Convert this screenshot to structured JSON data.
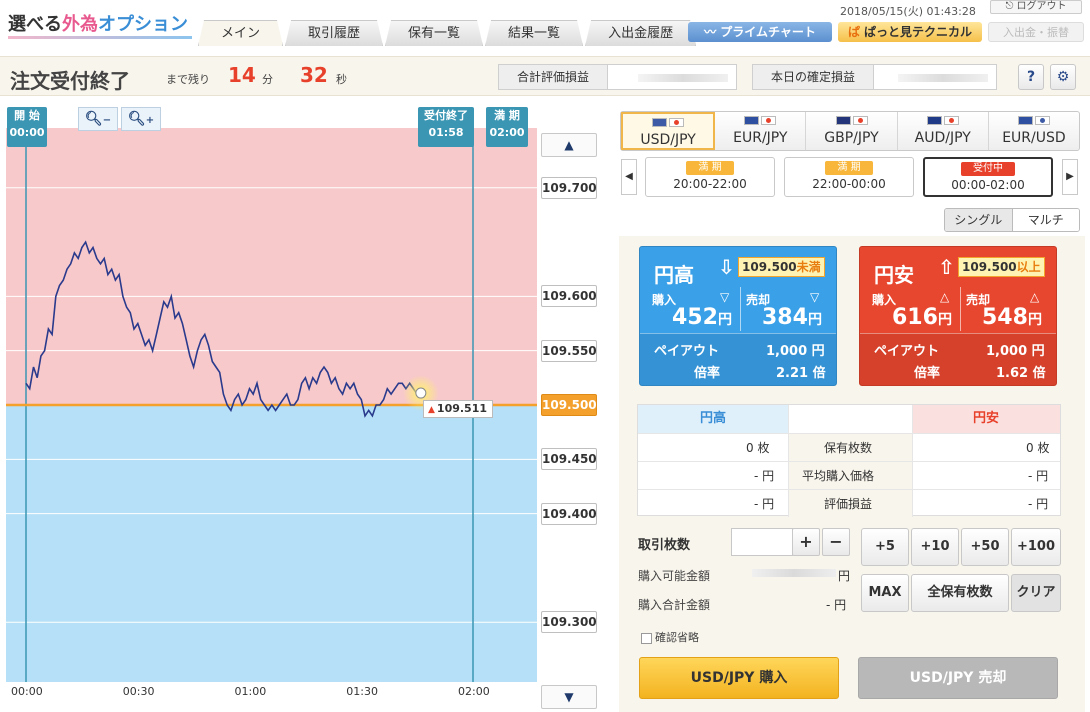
{
  "header": {
    "logo_a": "選べる",
    "logo_b": "外為",
    "logo_c": "オプション",
    "tabs": [
      {
        "label": "メイン",
        "active": true
      },
      {
        "label": "取引履歴",
        "active": false
      },
      {
        "label": "保有一覧",
        "active": false
      },
      {
        "label": "結果一覧",
        "active": false
      },
      {
        "label": "入出金履歴",
        "active": false
      }
    ],
    "prime_chart": "プライムチャート",
    "quick_tech_mark": "ぱ",
    "quick_tech": "ぱっと見テクニカル",
    "deposit": "入出金・振替",
    "datetime": "2018/05/15(火) 01:43:28",
    "logout": "ログアウト"
  },
  "status": {
    "title": "注文受付終了",
    "remain_label": "まで残り",
    "minutes": "14",
    "minutes_unit": "分",
    "seconds": "32",
    "seconds_unit": "秒",
    "total_pnl_label": "合計評価損益",
    "today_pnl_label": "本日の確定損益",
    "help": "?",
    "settings": "⚙"
  },
  "chart": {
    "start_flag_label": "開 始",
    "start_flag_time": "00:00",
    "close_flag_label": "受付終了",
    "close_flag_time": "01:58",
    "expiry_flag_label": "満 期",
    "expiry_flag_time": "02:00",
    "zoom_out": "−",
    "zoom_in": "+",
    "scroll_up": "▲",
    "scroll_down": "▼",
    "current_price": "109.511",
    "strike_price": "109.500",
    "colors": {
      "above": "#f7c9cb",
      "below": "#b6e0f7",
      "line": "#2a3a8c",
      "strike": "#f3a02d"
    }
  },
  "chart_data": {
    "type": "line",
    "x_ticks": [
      "00:00",
      "00:30",
      "01:00",
      "01:30",
      "02:00"
    ],
    "y_ticks": [
      "109.700",
      "109.600",
      "109.550",
      "109.500",
      "109.450",
      "109.400",
      "109.300"
    ],
    "xlim": [
      0,
      120
    ],
    "ylim": [
      109.245,
      109.755
    ],
    "strike": 109.5,
    "series": [
      {
        "x": [
          0,
          1,
          2,
          3,
          4,
          5,
          6,
          7,
          8,
          9,
          10,
          11,
          12,
          13,
          14,
          15,
          16,
          17,
          18,
          19,
          20,
          21,
          22,
          23,
          24,
          25,
          26,
          27,
          28,
          29,
          30,
          31,
          32,
          33,
          34,
          35,
          36,
          37,
          38,
          39,
          40,
          41,
          42,
          43,
          44,
          45,
          46,
          47,
          48,
          49,
          50,
          51,
          52,
          53,
          54,
          55,
          56,
          57,
          58,
          59,
          60,
          61,
          62,
          63,
          64,
          65,
          66,
          67,
          68,
          69,
          70,
          71,
          72,
          73,
          74,
          75,
          76,
          77,
          78,
          79,
          80,
          81,
          82,
          83,
          84,
          85,
          86,
          87,
          88,
          89,
          90,
          91,
          92,
          93,
          94,
          95,
          96,
          97,
          98,
          99,
          100,
          101,
          102,
          103,
          104,
          105,
          106
        ],
        "y": [
          109.52,
          109.515,
          109.535,
          109.525,
          109.545,
          109.55,
          109.57,
          109.565,
          109.6,
          109.61,
          109.615,
          109.625,
          109.63,
          109.64,
          109.635,
          109.645,
          109.65,
          109.64,
          109.645,
          109.635,
          109.63,
          109.635,
          109.62,
          109.625,
          109.615,
          109.62,
          109.6,
          109.59,
          109.585,
          109.57,
          109.575,
          109.565,
          109.555,
          109.56,
          109.55,
          109.565,
          109.58,
          109.595,
          109.59,
          109.6,
          109.58,
          109.585,
          109.575,
          109.56,
          109.545,
          109.535,
          109.55,
          109.56,
          109.565,
          109.555,
          109.54,
          109.535,
          109.53,
          109.51,
          109.5,
          109.495,
          109.505,
          109.51,
          109.5,
          109.505,
          109.515,
          109.51,
          109.52,
          109.505,
          109.5,
          109.495,
          109.5,
          109.495,
          109.5,
          109.505,
          109.51,
          109.5,
          109.5,
          109.505,
          109.52,
          109.525,
          109.515,
          109.525,
          109.52,
          109.53,
          109.535,
          109.53,
          109.52,
          109.525,
          109.515,
          109.51,
          109.52,
          109.515,
          109.52,
          109.51,
          109.505,
          109.49,
          109.495,
          109.49,
          109.5,
          109.5,
          109.505,
          109.515,
          109.51,
          109.515,
          109.52,
          109.52,
          109.515,
          109.52,
          109.515,
          109.51,
          109.511
        ]
      }
    ]
  },
  "pairs": [
    {
      "name": "USD/JPY",
      "active": true,
      "flag1": "#3c5aa6",
      "flag2": "#e8412b"
    },
    {
      "name": "EUR/JPY",
      "active": false,
      "flag1": "#2f4fa0",
      "flag2": "#e8412b"
    },
    {
      "name": "GBP/JPY",
      "active": false,
      "flag1": "#24357a",
      "flag2": "#e8412b"
    },
    {
      "name": "AUD/JPY",
      "active": false,
      "flag1": "#1f3a86",
      "flag2": "#e8412b"
    },
    {
      "name": "EUR/USD",
      "active": false,
      "flag1": "#2f4fa0",
      "flag2": "#3c5aa6"
    }
  ],
  "slots": [
    {
      "badge": "満 期",
      "time": "20:00-22:00",
      "active": false
    },
    {
      "badge": "満 期",
      "time": "22:00-00:00",
      "active": false
    },
    {
      "badge": "受付中",
      "time": "00:00-02:00",
      "active": true
    }
  ],
  "slot_prev": "◀",
  "slot_next": "▶",
  "mode": {
    "single": "シングル",
    "multi": "マルチ"
  },
  "cards": {
    "down": {
      "title": "円高",
      "arrow": "⇩",
      "strike": "109.500",
      "strike_suffix": "未満",
      "buy_label": "購入",
      "buy_price": "452",
      "sell_label": "売却",
      "sell_price": "384",
      "yen": "円",
      "payout_label": "ペイアウト",
      "payout": "1,000 円",
      "ratio_label": "倍率",
      "ratio": "2.21 倍",
      "tri": "▽"
    },
    "up": {
      "title": "円安",
      "arrow": "⇧",
      "strike": "109.500",
      "strike_suffix": "以上",
      "buy_label": "購入",
      "buy_price": "616",
      "sell_label": "売却",
      "sell_price": "548",
      "yen": "円",
      "payout_label": "ペイアウト",
      "payout": "1,000 円",
      "ratio_label": "倍率",
      "ratio": "1.62 倍",
      "tri": "△"
    }
  },
  "holdings": {
    "head_left": "円高",
    "head_right": "円安",
    "rows": [
      {
        "left": "0 枚",
        "label": "保有枚数",
        "right": "0 枚"
      },
      {
        "left": "- 円",
        "label": "平均購入価格",
        "right": "- 円"
      },
      {
        "left": "- 円",
        "label": "評価損益",
        "right": "- 円"
      }
    ]
  },
  "trade": {
    "qty_label": "取引枚数",
    "qty_value": "",
    "plus": "+",
    "minus": "−",
    "quick": [
      "+5",
      "+10",
      "+50",
      "+100"
    ],
    "max": "MAX",
    "all_hold": "全保有枚数",
    "clear": "クリア",
    "available_label": "購入可能金額",
    "available_unit": "円",
    "total_label": "購入合計金額",
    "total_value": "- 円",
    "skip_confirm": "確認省略",
    "buy": "USD/JPY 購入",
    "sell": "USD/JPY 売却"
  }
}
